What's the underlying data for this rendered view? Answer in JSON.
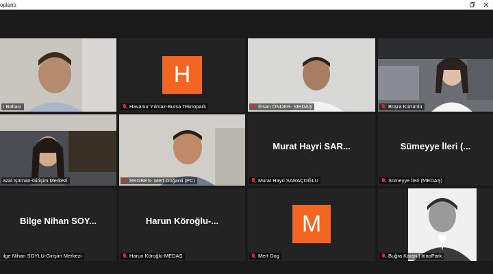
{
  "window": {
    "title": "oplantı",
    "minimize_icon": "restore-icon",
    "close_icon": "close-icon"
  },
  "colors": {
    "active_speaker": "#b5e61d",
    "avatar_orange": "#f26522",
    "muted_red": "#e02828"
  },
  "tiles": [
    {
      "name": "r Baltacı",
      "type": "video",
      "active": true
    },
    {
      "name": "Havanur Yılmaz-Bursa Teknopark",
      "type": "avatar",
      "initial": "H"
    },
    {
      "name": "İhsan ÖNDER- MEDAŞ",
      "type": "video"
    },
    {
      "name": "Büşra Kürümlü",
      "type": "video"
    },
    {
      "name": "azal Işıtman-Girişim Merkezi",
      "type": "video"
    },
    {
      "name": "REGBES- Mert Doğanli (PC)",
      "type": "video"
    },
    {
      "name": "Murat Hayri SARAÇOĞLU",
      "type": "namecard",
      "card": "Murat Hayri SAR..."
    },
    {
      "name": "Sümeyye İleri (MEDAŞ)",
      "type": "namecard",
      "card": "Sümeyye İleri (..."
    },
    {
      "name": "ilge Nihan SOYLU-Girişim Merkezi",
      "type": "namecard",
      "card": "Bilge Nihan SOY..."
    },
    {
      "name": "Harun Köroğlu-MEDAŞ",
      "type": "namecard",
      "card": "Harun Köroğlu-..."
    },
    {
      "name": "Mert Dog",
      "type": "avatar",
      "initial": "M"
    },
    {
      "name": "Buğra Karan | InnoPark",
      "type": "photo"
    }
  ]
}
